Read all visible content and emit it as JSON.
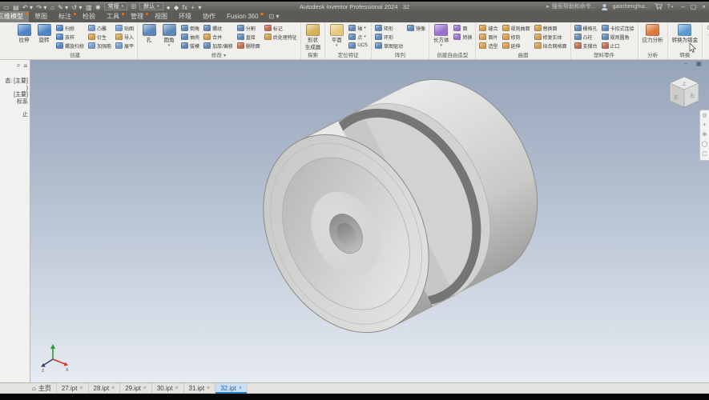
{
  "window": {
    "title": "Autodesk Inventor Professional 2024",
    "doc_id": "32",
    "min_glyph": "–",
    "restore_glyph": "▢",
    "close_glyph": "×"
  },
  "qat": {
    "icons": [
      {
        "name": "open-icon",
        "glyph": "▭"
      },
      {
        "name": "save-icon",
        "glyph": "▤"
      },
      {
        "name": "undo-icon",
        "glyph": "↶ ▾"
      },
      {
        "name": "redo-icon",
        "glyph": "↷ ▾"
      },
      {
        "name": "home-icon",
        "glyph": "⌂"
      },
      {
        "name": "sketch-icon",
        "glyph": "✎ ▾"
      },
      {
        "name": "update-icon",
        "glyph": "↺ ▾"
      },
      {
        "name": "measure-icon",
        "glyph": "▥"
      },
      {
        "name": "gear-icon",
        "glyph": "✱"
      }
    ],
    "material_dropdown": "常规",
    "appearance_icon": "◎",
    "appearance_dropdown": "默认",
    "extra_icons": [
      {
        "name": "color-ball-icon",
        "glyph": "●"
      },
      {
        "name": "team-icon",
        "glyph": "◆"
      },
      {
        "name": "parameters-fx-icon",
        "glyph": "fx"
      },
      {
        "name": "plus-icon",
        "glyph": "+"
      },
      {
        "name": "more-icon",
        "glyph": "▾"
      }
    ]
  },
  "titlebar_right": {
    "search_placeholder": "搜索帮助和命令...",
    "user": "gaochenghui...",
    "help_label": "?",
    "help_caret": "▾"
  },
  "ribbon_tabs": [
    {
      "label": "三维模型",
      "active": true,
      "badge": true
    },
    {
      "label": "草图",
      "active": false,
      "badge": false
    },
    {
      "label": "标注",
      "active": false,
      "badge": true
    },
    {
      "label": "检验",
      "active": false,
      "badge": false
    },
    {
      "label": "工具",
      "active": false,
      "badge": true
    },
    {
      "label": "管理",
      "active": false,
      "badge": true
    },
    {
      "label": "视图",
      "active": false,
      "badge": false
    },
    {
      "label": "环境",
      "active": false,
      "badge": false
    },
    {
      "label": "协作",
      "active": false,
      "badge": false
    },
    {
      "label": "Fusion 360",
      "active": false,
      "badge": true
    }
  ],
  "tab_overflow_glyph": "⊡ ▾",
  "ribbon": {
    "end_icon": "⊙ ·",
    "panels": [
      {
        "label": "创建",
        "menu": false,
        "groups": [
          {
            "type": "big",
            "items": [
              {
                "label": "拉伸",
                "icon": "extrude-icon",
                "c": "#4d84c8"
              },
              {
                "label": "旋转",
                "icon": "revolve-icon",
                "c": "#4d84c8"
              }
            ]
          },
          {
            "type": "col",
            "items": [
              {
                "label": "扫掠",
                "icon": "sweep-icon",
                "c": "#4d84c8"
              },
              {
                "label": "放样",
                "icon": "loft-icon",
                "c": "#4d84c8"
              },
              {
                "label": "螺旋扫掠",
                "icon": "coil-icon",
                "c": "#4d84c8"
              }
            ]
          },
          {
            "type": "col",
            "items": [
              {
                "label": "凸雕",
                "icon": "emboss-icon",
                "c": "#6f9bd0"
              },
              {
                "label": "衍生",
                "icon": "derive-icon",
                "c": "#d79b46"
              },
              {
                "label": "加强筋",
                "icon": "rib-icon",
                "c": "#6f9bd0"
              }
            ]
          },
          {
            "type": "col",
            "items": [
              {
                "label": "贴图",
                "icon": "decal-icon",
                "c": "#6f9bd0"
              },
              {
                "label": "导入",
                "icon": "import-icon",
                "c": "#caa34e"
              },
              {
                "label": "展平",
                "icon": "unwrap-icon",
                "c": "#6f9bd0"
              }
            ]
          }
        ]
      },
      {
        "label": "修改",
        "menu": true,
        "groups": [
          {
            "type": "big",
            "items": [
              {
                "label": "孔",
                "icon": "hole-icon",
                "c": "#5c87b8"
              },
              {
                "label": "圆角",
                "icon": "fillet-icon",
                "c": "#5c87b8",
                "dd": true
              }
            ]
          },
          {
            "type": "col",
            "items": [
              {
                "label": "倒角",
                "icon": "chamfer-icon",
                "c": "#5c87b8"
              },
              {
                "label": "抽壳",
                "icon": "shell-icon",
                "c": "#5c87b8"
              },
              {
                "label": "拔模",
                "icon": "draft-icon",
                "c": "#5c87b8"
              }
            ]
          },
          {
            "type": "col",
            "items": [
              {
                "label": "螺纹",
                "icon": "thread-icon",
                "c": "#5c87b8"
              },
              {
                "label": "合并",
                "icon": "combine-icon",
                "c": "#d79b46"
              },
              {
                "label": "加厚/偏移",
                "icon": "thicken-offset-icon",
                "c": "#5c87b8"
              }
            ]
          },
          {
            "type": "col",
            "items": [
              {
                "label": "分割",
                "icon": "split-icon",
                "c": "#5c87b8"
              },
              {
                "label": "直接",
                "icon": "direct-edit-icon",
                "c": "#5c87b8"
              },
              {
                "label": "删除面",
                "icon": "delete-face-icon",
                "c": "#c06a4a"
              }
            ]
          },
          {
            "type": "col",
            "items": [
              {
                "label": "标记",
                "icon": "mark-icon",
                "c": "#c06a4a"
              },
              {
                "label": "后处理特征",
                "icon": "finish-feature-icon",
                "c": "#d79b46"
              }
            ]
          }
        ]
      },
      {
        "label": "探索",
        "menu": false,
        "groups": [
          {
            "type": "big",
            "items": [
              {
                "label": "形状",
                "label2": "生成器",
                "icon": "shape-generator-icon",
                "c": "#d8b25a"
              }
            ]
          }
        ]
      },
      {
        "label": "定位特征",
        "menu": false,
        "groups": [
          {
            "type": "big",
            "items": [
              {
                "label": "平面",
                "icon": "work-plane-icon",
                "c": "#e8c87a",
                "dd": true
              }
            ]
          },
          {
            "type": "col",
            "items": [
              {
                "label": "轴",
                "icon": "work-axis-icon",
                "c": "#5c87b8",
                "dd": true
              },
              {
                "label": "点",
                "icon": "work-point-icon",
                "c": "#5c87b8",
                "dd": true
              },
              {
                "label": "UCS",
                "icon": "ucs-icon",
                "c": "#5c87b8"
              }
            ]
          }
        ]
      },
      {
        "label": "阵列",
        "menu": false,
        "groups": [
          {
            "type": "col",
            "items": [
              {
                "label": "矩形",
                "icon": "rectangular-pattern-icon",
                "c": "#5c87b8"
              },
              {
                "label": "环形",
                "icon": "circular-pattern-icon",
                "c": "#5c87b8"
              },
              {
                "label": "草图驱动",
                "icon": "sketch-driven-pattern-icon",
                "c": "#5c87b8"
              }
            ]
          },
          {
            "type": "col",
            "items": [
              {
                "label": "镜像",
                "icon": "mirror-icon",
                "c": "#5c87b8"
              }
            ]
          }
        ]
      },
      {
        "label": "创建自由造型",
        "menu": false,
        "groups": [
          {
            "type": "big",
            "items": [
              {
                "label": "长方体",
                "icon": "freeform-box-icon",
                "c": "#9a6fd0",
                "dd": true
              }
            ]
          },
          {
            "type": "col",
            "items": [
              {
                "label": "面",
                "icon": "freeform-face-icon",
                "c": "#9a6fd0"
              },
              {
                "label": "转换",
                "icon": "freeform-convert-icon",
                "c": "#9a6fd0"
              }
            ]
          }
        ]
      },
      {
        "label": "曲面",
        "menu": false,
        "groups": [
          {
            "type": "col",
            "items": [
              {
                "label": "缝合",
                "icon": "stitch-icon",
                "c": "#d79b46"
              },
              {
                "label": "面片",
                "icon": "patch-icon",
                "c": "#d79b46"
              },
              {
                "label": "造型",
                "icon": "sculpt-icon",
                "c": "#d79b46"
              }
            ]
          },
          {
            "type": "col",
            "items": [
              {
                "label": "规则曲面",
                "icon": "ruled-surface-icon",
                "c": "#d79b46"
              },
              {
                "label": "修剪",
                "icon": "trim-icon",
                "c": "#d79b46"
              },
              {
                "label": "延伸",
                "icon": "extend-icon",
                "c": "#d79b46"
              }
            ]
          },
          {
            "type": "col",
            "items": [
              {
                "label": "替换面",
                "icon": "replace-face-icon",
                "c": "#d79b46"
              },
              {
                "label": "修复实体",
                "icon": "repair-bodies-icon",
                "c": "#d79b46"
              },
              {
                "label": "拟合网格面",
                "icon": "fit-mesh-face-icon",
                "c": "#d79b46"
              }
            ]
          }
        ]
      },
      {
        "label": "塑料零件",
        "menu": false,
        "groups": [
          {
            "type": "col",
            "items": [
              {
                "label": "栅格孔",
                "icon": "grill-icon",
                "c": "#5c87b8"
              },
              {
                "label": "凸柱",
                "icon": "boss-icon",
                "c": "#5c87b8"
              },
              {
                "label": "支撑台",
                "icon": "rest-icon",
                "c": "#c06a4a"
              }
            ]
          },
          {
            "type": "col",
            "items": [
              {
                "label": "卡扣式连接",
                "icon": "snap-fit-icon",
                "c": "#5c87b8"
              },
              {
                "label": "规则圆角",
                "icon": "rule-fillet-icon",
                "c": "#5c87b8"
              },
              {
                "label": "止口",
                "icon": "lip-icon",
                "c": "#c06a4a"
              }
            ]
          }
        ]
      },
      {
        "label": "分析",
        "menu": false,
        "groups": [
          {
            "type": "big",
            "items": [
              {
                "label": "应力分析",
                "icon": "stress-analysis-icon",
                "c": "#e0783c"
              }
            ]
          }
        ]
      },
      {
        "label": "转换",
        "menu": false,
        "groups": [
          {
            "type": "big",
            "items": [
              {
                "label": "转换为钣金",
                "icon": "convert-to-sheet-metal-icon",
                "c": "#5a9bd4"
              }
            ]
          }
        ]
      }
    ]
  },
  "browser": {
    "search_icon": "⌕",
    "menu_icon": "≡",
    "lines": [
      "态: [主要]",
      ")",
      "[主要]",
      "标系",
      "止"
    ]
  },
  "viewcube": {
    "top": "上",
    "front": "前",
    "right": "右"
  },
  "navbar_icons": [
    {
      "name": "steering-wheel-icon",
      "glyph": "◎"
    },
    {
      "name": "pan-icon",
      "glyph": "+"
    },
    {
      "name": "zoom-icon",
      "glyph": "⊕"
    },
    {
      "name": "orbit-icon",
      "glyph": "◯"
    },
    {
      "name": "look-at-icon",
      "glyph": "▢"
    }
  ],
  "doc_tabs": {
    "home_label": "主页",
    "home_icon": "⌂",
    "close_glyph": "×",
    "tabs": [
      {
        "label": "27.ipt",
        "active": false
      },
      {
        "label": "28.ipt",
        "active": false
      },
      {
        "label": "29.ipt",
        "active": false
      },
      {
        "label": "30.ipt",
        "active": false
      },
      {
        "label": "31.ipt",
        "active": false
      },
      {
        "label": "32.ipt",
        "active": true
      }
    ]
  },
  "colors": {
    "accent_blue": "#2d7fc4",
    "badge_orange": "#e8731c",
    "viewport_top": "#96a4ba",
    "viewport_bottom": "#e7ebf2",
    "model_gray": "#d2d3d1"
  }
}
